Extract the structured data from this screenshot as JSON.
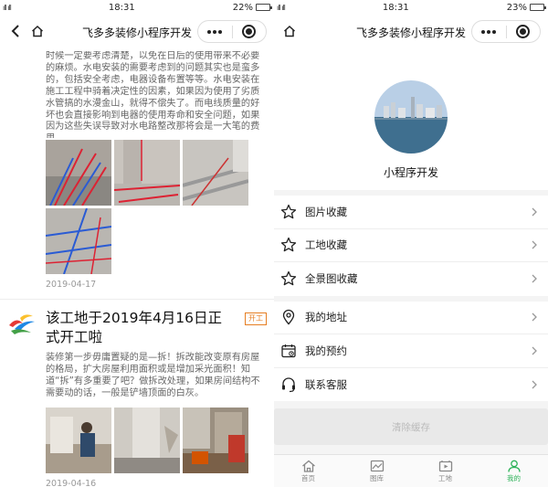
{
  "left": {
    "status": {
      "signal": "ıll ıll",
      "time": "18:31",
      "battery": "22%",
      "battery_level": 0.22
    },
    "nav": {
      "title": "飞多多装修小程序开发"
    },
    "post1": {
      "text": "时候一定要考虑清楚，以免在日后的使用带来不必要的麻烦。水电安装的需要考虑到的问题其实也是蛮多的，包括安全考虑，电器设备布置等等。水电安装在施工工程中骑着决定性的因素，如果因为使用了劣质水管搞的水漫金山，就得不偿失了。而电线质量的好坏也会直接影响到电器的使用寿命和安全问题，如果因为这些失误导致对水电路整改那将会是一大笔的费用。",
      "date": "2019-04-17"
    },
    "post2": {
      "title": "该工地于2019年4月16日正式开工啦",
      "tag": "开工",
      "text": "装修第一步毋庸置疑的是—拆！拆改能改变原有房屋的格局，扩大房屋利用面积或是增加采光面积！知道“拆”有多重要了吧？做拆改处理，如果房间结构不需要动的话，一般是铲墙顶面的白灰。",
      "date": "2019-04-16"
    }
  },
  "right": {
    "status": {
      "signal": "ıll ıll",
      "time": "18:31",
      "battery": "23%",
      "battery_level": 0.23
    },
    "nav": {
      "title": "飞多多装修小程序开发"
    },
    "profile": {
      "name": "小程序开发"
    },
    "menu_group1": [
      {
        "label": "图片收藏",
        "icon": "star-icon"
      },
      {
        "label": "工地收藏",
        "icon": "star-icon"
      },
      {
        "label": "全景图收藏",
        "icon": "star-icon"
      }
    ],
    "menu_group2": [
      {
        "label": "我的地址",
        "icon": "location-pin-icon"
      },
      {
        "label": "我的预约",
        "icon": "calendar-icon"
      },
      {
        "label": "联系客服",
        "icon": "headset-icon"
      }
    ],
    "clear_cache": "清除缓存",
    "tabs": [
      {
        "label": "首页",
        "icon": "home-icon",
        "active": false
      },
      {
        "label": "图库",
        "icon": "gallery-icon",
        "active": false
      },
      {
        "label": "工地",
        "icon": "video-icon",
        "active": false
      },
      {
        "label": "我的",
        "icon": "profile-icon",
        "active": true
      }
    ],
    "colors": {
      "active_tab": "#2fb35a",
      "tag": "#e67e22"
    }
  }
}
